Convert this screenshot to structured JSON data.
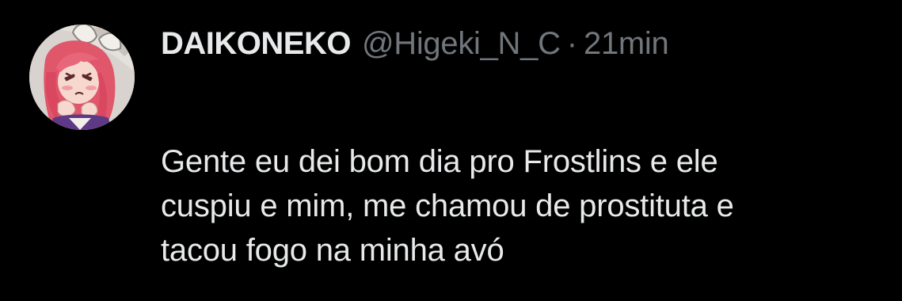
{
  "tweet": {
    "display_name": "DAIKONEKO",
    "handle": "@Higeki_N_C",
    "separator": "·",
    "time": "21min",
    "text_lines": [
      "Gente eu dei bom dia pro Frostlins e ele",
      "cuspiu e mim, me chamou de prostituta e",
      "tacou fogo na minha avó"
    ]
  },
  "colors": {
    "background": "#000000",
    "primary_text": "#e7e9ea",
    "secondary_text": "#71767b"
  },
  "icons": {
    "avatar": "anime-character-avatar"
  }
}
